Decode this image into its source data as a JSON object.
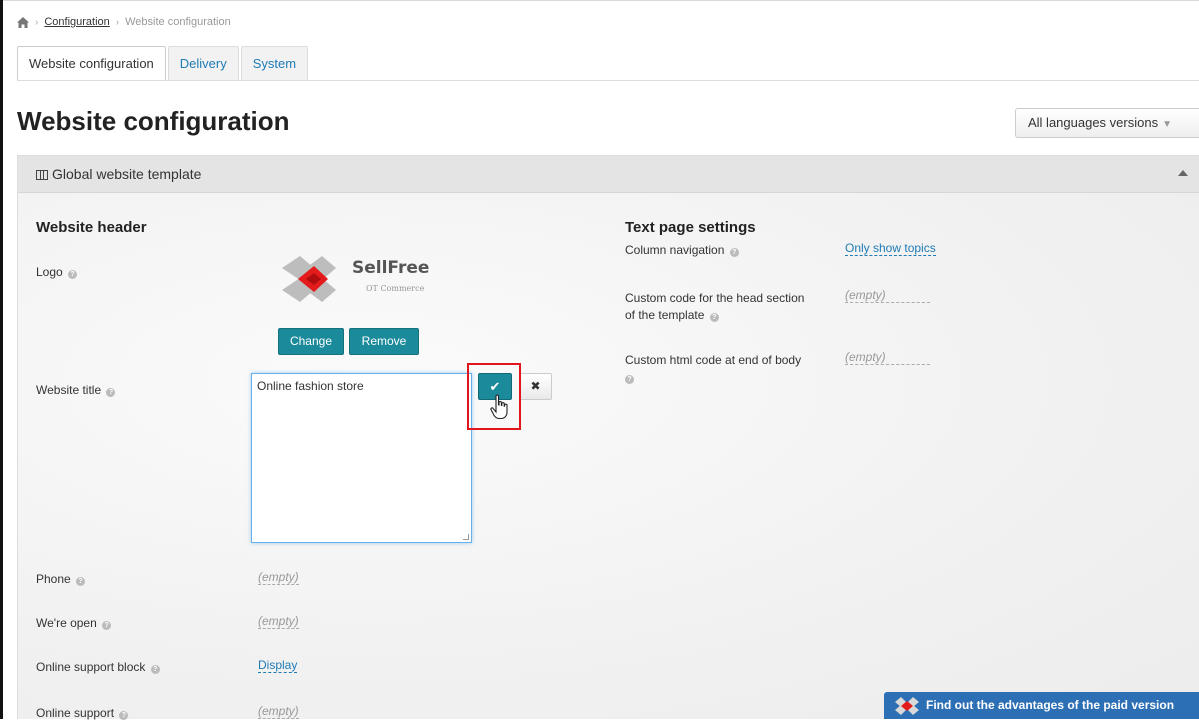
{
  "breadcrumb": {
    "parent": "Configuration",
    "current": "Website configuration"
  },
  "tabs": [
    {
      "label": "Website configuration",
      "active": true
    },
    {
      "label": "Delivery",
      "active": false
    },
    {
      "label": "System",
      "active": false
    }
  ],
  "page_title": "Website configuration",
  "language_dropdown": {
    "selected": "All languages versions"
  },
  "panel": {
    "title": "Global website template",
    "header_section": {
      "heading": "Website header",
      "logo_label": "Logo",
      "logo_text": "SellFree",
      "logo_subtext": "OT Commerce",
      "change_label": "Change",
      "remove_label": "Remove",
      "website_title_label": "Website title",
      "website_title_value": "Online fashion store",
      "ok_symbol": "✔",
      "cancel_symbol": "✖",
      "phone_label": "Phone",
      "phone_value": "(empty)",
      "open_label": "We're open",
      "open_value": "(empty)",
      "support_block_label": "Online support block",
      "support_block_value": "Display",
      "support_label": "Online support",
      "support_value": "(empty)"
    },
    "text_page_section": {
      "heading": "Text page settings",
      "column_nav_label": "Column navigation",
      "column_nav_value": "Only show topics",
      "head_code_label_1": "Custom code for the head section",
      "head_code_label_2": "of the template",
      "head_code_value": "(empty)",
      "body_code_label": "Custom html code at end of body",
      "body_code_value": "(empty)"
    }
  },
  "promo": {
    "label": "Find out the advantages of the paid version"
  },
  "colors": {
    "accent": "#1b8a9b",
    "link": "#1f7bb6",
    "highlight": "#e0161c",
    "promo": "#2d6fb5"
  }
}
